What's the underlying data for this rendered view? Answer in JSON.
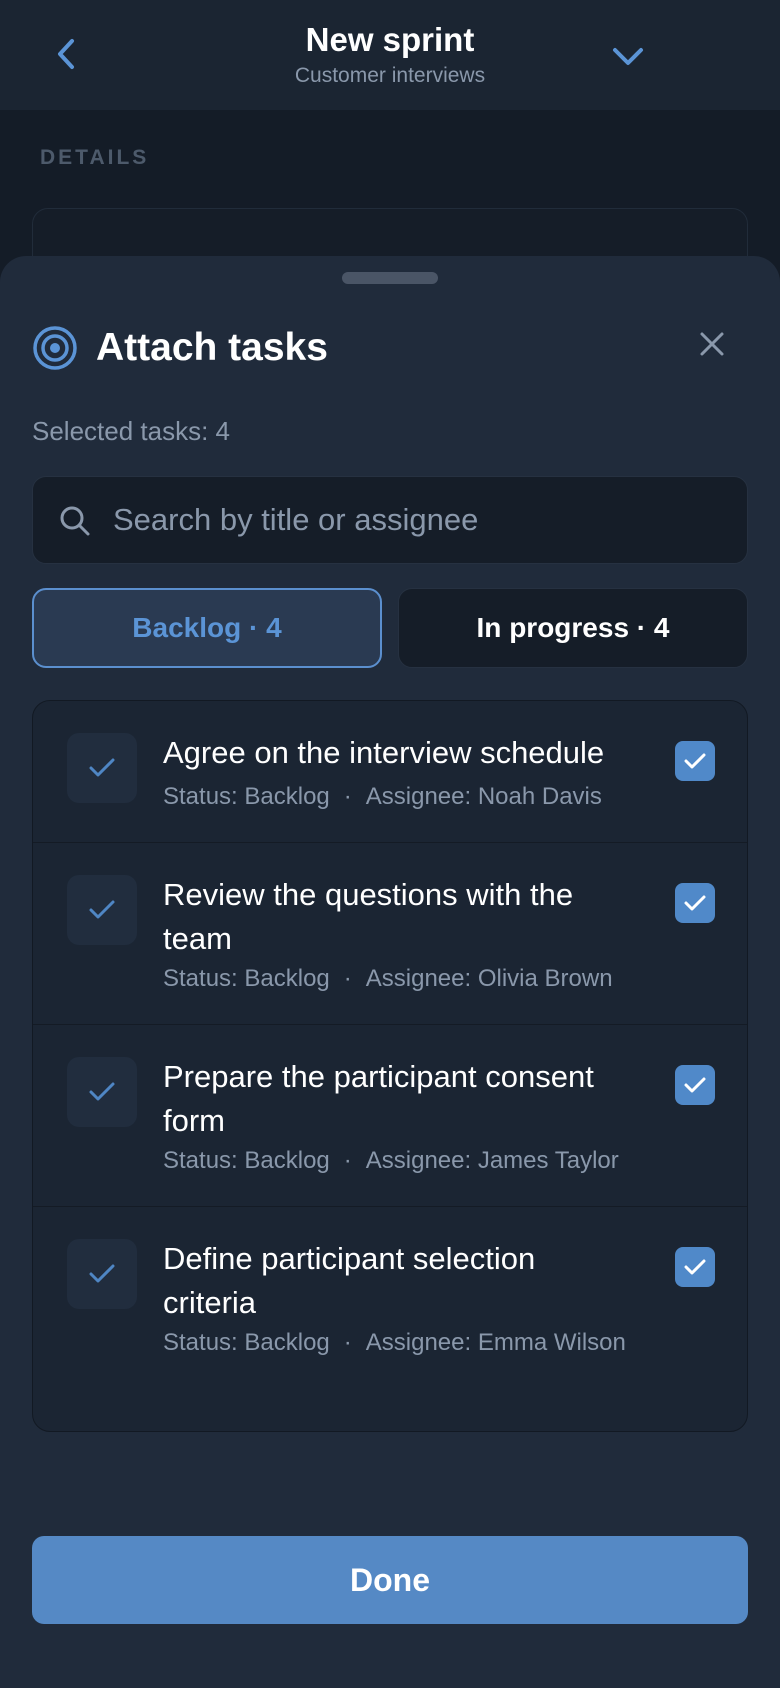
{
  "header": {
    "title": "New sprint",
    "subtitle": "Customer interviews",
    "back_icon": "chevron-left-icon",
    "menu_icon": "chevron-down-icon"
  },
  "details": {
    "section_label": "DETAILS"
  },
  "sheet": {
    "title": "Attach tasks",
    "icon": "target-icon",
    "close_icon": "close-icon",
    "selected_label": "Selected tasks: 4",
    "search": {
      "placeholder": "Search by title or assignee",
      "value": ""
    },
    "tabs": [
      {
        "label": "Backlog · 4",
        "active": true
      },
      {
        "label": "In progress · 4",
        "active": false
      }
    ],
    "tasks": [
      {
        "title": "Agree on the interview schedule",
        "status": "Status: Backlog",
        "assignee": "Assignee: Noah Davis",
        "checked": true
      },
      {
        "title": "Review the questions with the team",
        "status": "Status: Backlog",
        "assignee": "Assignee: Olivia Brown",
        "checked": true
      },
      {
        "title": "Prepare the participant consent form",
        "status": "Status: Backlog",
        "assignee": "Assignee: James Taylor",
        "checked": true
      },
      {
        "title": "Define participant selection criteria",
        "status": "Status: Backlog",
        "assignee": "Assignee: Emma Wilson",
        "checked": true
      }
    ],
    "meta_separator": "·",
    "done_label": "Done"
  },
  "colors": {
    "accent": "#5589c5",
    "background": "#141c27",
    "sheet": "#202b3b",
    "muted_text": "#8a98ab"
  }
}
